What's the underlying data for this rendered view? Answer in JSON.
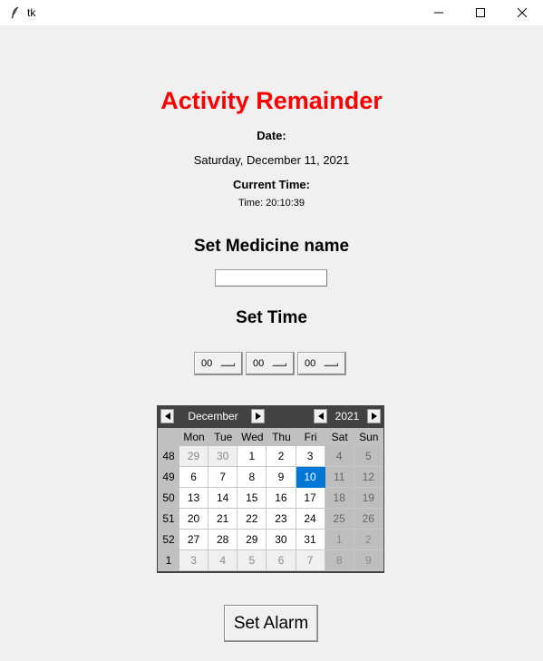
{
  "window": {
    "title": "tk",
    "icon": "feather-icon",
    "controls": [
      "minimize-icon",
      "maximize-icon",
      "close-icon"
    ]
  },
  "app": {
    "heading": "Activity Remainder",
    "heading_color": "#ff0000",
    "date_label": "Date:",
    "date_value": "Saturday, December 11, 2021",
    "time_label": "Current Time:",
    "time_value": "Time: 20:10:39",
    "medicine_heading": "Set Medicine name",
    "medicine_value": "",
    "settime_heading": "Set Time",
    "spinboxes": [
      {
        "value": "00"
      },
      {
        "value": "00"
      },
      {
        "value": "00"
      }
    ],
    "set_alarm_label": "Set Alarm"
  },
  "calendar": {
    "month": "December",
    "year": "2021",
    "selected_color": "#0078d7",
    "header_color": "#424242",
    "weekdays": [
      "Mon",
      "Tue",
      "Wed",
      "Thu",
      "Fri",
      "Sat",
      "Sun"
    ],
    "weeks": [
      {
        "num": "48",
        "days": [
          {
            "d": "29",
            "om": true
          },
          {
            "d": "30",
            "om": true
          },
          {
            "d": "1"
          },
          {
            "d": "2"
          },
          {
            "d": "3"
          },
          {
            "d": "4"
          },
          {
            "d": "5"
          }
        ]
      },
      {
        "num": "49",
        "days": [
          {
            "d": "6"
          },
          {
            "d": "7"
          },
          {
            "d": "8"
          },
          {
            "d": "9"
          },
          {
            "d": "10",
            "sel": true
          },
          {
            "d": "11"
          },
          {
            "d": "12"
          }
        ]
      },
      {
        "num": "50",
        "days": [
          {
            "d": "13"
          },
          {
            "d": "14"
          },
          {
            "d": "15"
          },
          {
            "d": "16"
          },
          {
            "d": "17"
          },
          {
            "d": "18"
          },
          {
            "d": "19"
          }
        ]
      },
      {
        "num": "51",
        "days": [
          {
            "d": "20"
          },
          {
            "d": "21"
          },
          {
            "d": "22"
          },
          {
            "d": "23"
          },
          {
            "d": "24"
          },
          {
            "d": "25"
          },
          {
            "d": "26"
          }
        ]
      },
      {
        "num": "52",
        "days": [
          {
            "d": "27"
          },
          {
            "d": "28"
          },
          {
            "d": "29"
          },
          {
            "d": "30"
          },
          {
            "d": "31"
          },
          {
            "d": "1",
            "om": true
          },
          {
            "d": "2",
            "om": true
          }
        ]
      },
      {
        "num": "1",
        "days": [
          {
            "d": "3",
            "om": true
          },
          {
            "d": "4",
            "om": true
          },
          {
            "d": "5",
            "om": true
          },
          {
            "d": "6",
            "om": true
          },
          {
            "d": "7",
            "om": true
          },
          {
            "d": "8",
            "om": true
          },
          {
            "d": "9",
            "om": true
          }
        ]
      }
    ]
  }
}
